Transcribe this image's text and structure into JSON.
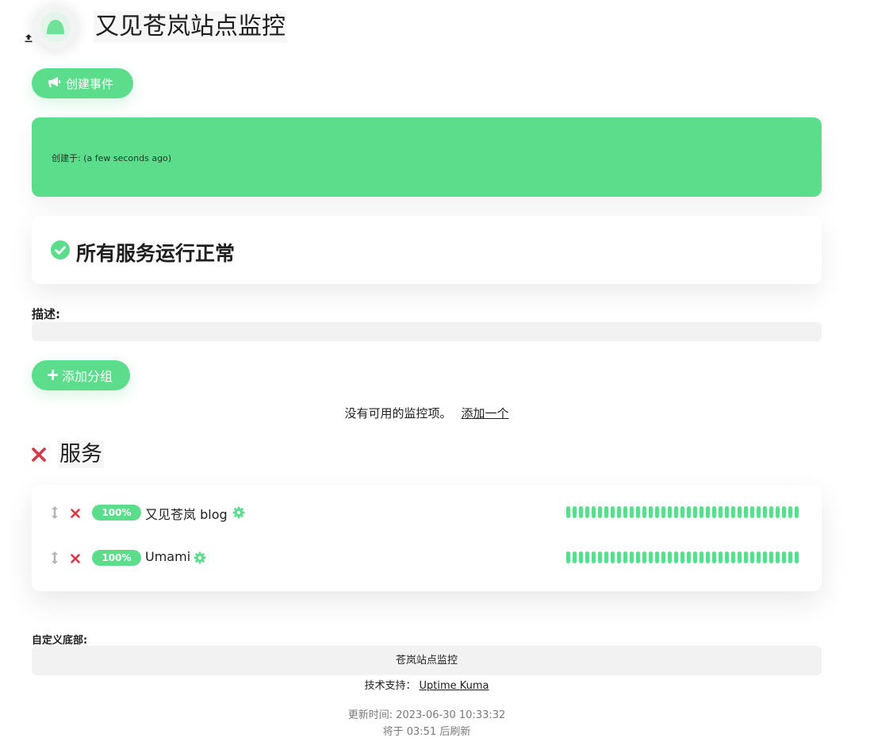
{
  "header": {
    "title": "又见苍岚站点监控",
    "logo_icon": "uptime-kuma-logo-icon",
    "upload_icon": "upload-icon"
  },
  "incident": {
    "create_button_label": "创建事件",
    "create_button_icon": "megaphone-icon",
    "created_text": "创建于: (a few seconds ago)",
    "color": "#5cdd8b"
  },
  "status": {
    "text": "所有服务运行正常",
    "icon": "check-circle-icon",
    "color": "#5cdd8b"
  },
  "description": {
    "label": "描述:",
    "value": ""
  },
  "add_group": {
    "label": "添加分组",
    "icon": "plus-icon"
  },
  "no_monitor": {
    "text": "没有可用的监控项。",
    "link": "添加一个"
  },
  "group": {
    "title": "服务",
    "remove_icon": "close-icon",
    "monitors": [
      {
        "uptime": "100%",
        "name": "又见苍岚 blog",
        "beats": 37
      },
      {
        "uptime": "100%",
        "name": "Umami",
        "beats": 37
      }
    ]
  },
  "footer": {
    "label": "自定义底部:",
    "text": "苍岚站点监控",
    "powered_prefix": "技术支持：",
    "powered_link": "Uptime Kuma",
    "updated": "更新时间: 2023-06-30 10:33:32",
    "refresh": "将于 03:51 后刷新"
  },
  "colors": {
    "accent": "#5cdd8b",
    "danger": "#dc3545"
  }
}
